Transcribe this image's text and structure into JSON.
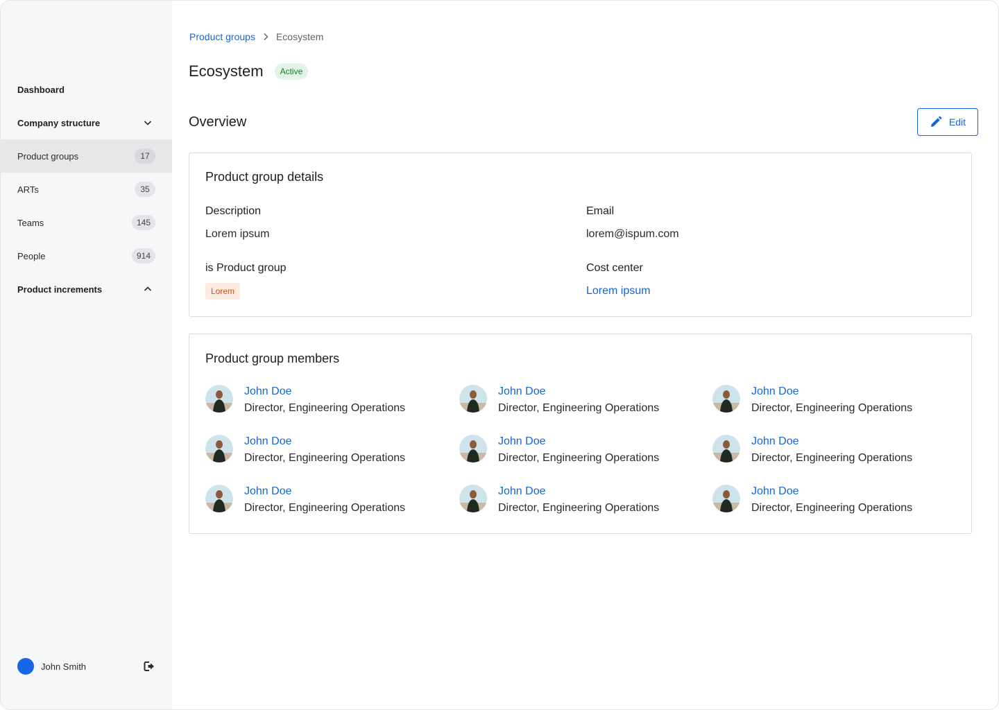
{
  "sidebar": {
    "items": [
      {
        "label": "Dashboard"
      },
      {
        "label": "Company structure"
      },
      {
        "label": "Product groups",
        "count": "17"
      },
      {
        "label": "ARTs",
        "count": "35"
      },
      {
        "label": "Teams",
        "count": "145"
      },
      {
        "label": "People",
        "count": "914"
      },
      {
        "label": "Product increments"
      }
    ],
    "user": {
      "name": "John Smith"
    }
  },
  "breadcrumb": {
    "parent": "Product groups",
    "current": "Ecosystem"
  },
  "page": {
    "title": "Ecosystem",
    "status": "Active"
  },
  "overview": {
    "title": "Overview",
    "edit_label": "Edit"
  },
  "details": {
    "title": "Product group details",
    "description_label": "Description",
    "description_value": "Lorem ipsum",
    "email_label": "Email",
    "email_value": "lorem@ispum.com",
    "is_product_group_label": "is Product group",
    "is_product_group_tag": "Lorem",
    "cost_center_label": "Cost center",
    "cost_center_value": "Lorem ipsum"
  },
  "members": {
    "title": "Product group members",
    "list": [
      {
        "name": "John Doe",
        "role": "Director, Engineering Operations"
      },
      {
        "name": "John Doe",
        "role": "Director, Engineering Operations"
      },
      {
        "name": "John Doe",
        "role": "Director, Engineering Operations"
      },
      {
        "name": "John Doe",
        "role": "Director, Engineering Operations"
      },
      {
        "name": "John Doe",
        "role": "Director, Engineering Operations"
      },
      {
        "name": "John Doe",
        "role": "Director, Engineering Operations"
      },
      {
        "name": "John Doe",
        "role": "Director, Engineering Operations"
      },
      {
        "name": "John Doe",
        "role": "Director, Engineering Operations"
      },
      {
        "name": "John Doe",
        "role": "Director, Engineering Operations"
      }
    ]
  },
  "colors": {
    "accent": "#1466d6",
    "active_badge_bg": "#e3f4e6",
    "active_badge_text": "#1d7a35",
    "tag_bg": "#fdebe2",
    "tag_text": "#c4521a",
    "user_avatar": "#1566e8"
  },
  "icons": {
    "company_structure": "chevron-down-icon",
    "product_increments": "chevron-up-icon",
    "breadcrumb_separator": "chevron-right-icon",
    "edit": "pencil-icon",
    "logout": "logout-icon"
  }
}
